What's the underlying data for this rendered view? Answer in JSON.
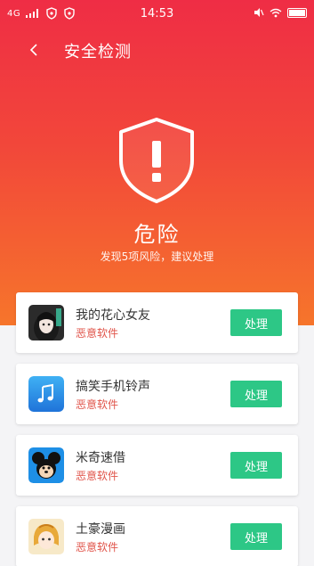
{
  "status_bar": {
    "carrier": "4G",
    "time": "14:53"
  },
  "nav": {
    "title": "安全检测",
    "back_icon": "chevron-left-icon"
  },
  "hero": {
    "shield_icon": "shield-exclamation-icon",
    "status_title": "危险",
    "status_subtitle": "发现5项风险，建议处理",
    "colors": {
      "gradient_top": "#ef2d45",
      "gradient_bottom": "#f6752b"
    }
  },
  "risk_items": [
    {
      "name": "我的花心女友",
      "tag": "恶意软件",
      "action": "处理",
      "icon": "anime-girl-app-icon"
    },
    {
      "name": "搞笑手机铃声",
      "tag": "恶意软件",
      "action": "处理",
      "icon": "music-note-app-icon"
    },
    {
      "name": "米奇速借",
      "tag": "恶意软件",
      "action": "处理",
      "icon": "mickey-app-icon"
    },
    {
      "name": "土豪漫画",
      "tag": "恶意软件",
      "action": "处理",
      "icon": "comic-app-icon"
    }
  ],
  "colors": {
    "action_button": "#2dc786",
    "tag_text": "#e0544a"
  }
}
